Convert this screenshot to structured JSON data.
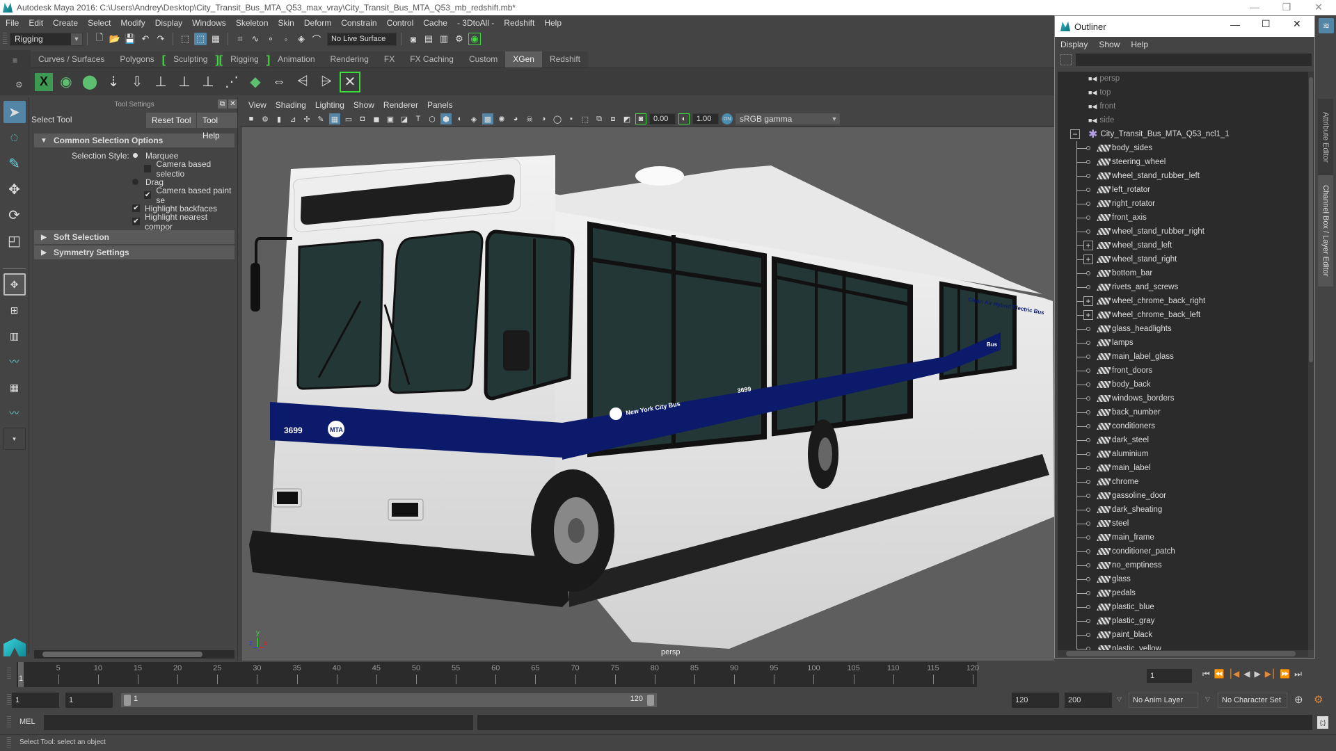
{
  "window": {
    "title": "Autodesk Maya 2016: C:\\Users\\Andrey\\Desktop\\City_Transit_Bus_MTA_Q53_max_vray\\City_Transit_Bus_MTA_Q53_mb_redshift.mb*",
    "minimize": "—",
    "restore": "❐",
    "close": "✕"
  },
  "menubar": [
    "File",
    "Edit",
    "Create",
    "Select",
    "Modify",
    "Display",
    "Windows",
    "Skeleton",
    "Skin",
    "Deform",
    "Constrain",
    "Control",
    "Cache",
    "- 3DtoAll -",
    "Redshift",
    "Help"
  ],
  "toolbar": {
    "menu_set": "Rigging",
    "live_surface": "No Live Surface"
  },
  "shelf": {
    "tabs": [
      {
        "label": "Curves / Surfaces"
      },
      {
        "label": "Polygons"
      },
      {
        "label": "Sculpting",
        "bracketed": true
      },
      {
        "label": "Rigging",
        "bracketed": true
      },
      {
        "label": "Animation"
      },
      {
        "label": "Rendering"
      },
      {
        "label": "FX"
      },
      {
        "label": "FX Caching"
      },
      {
        "label": "Custom"
      },
      {
        "label": "XGen",
        "active": true
      },
      {
        "label": "Redshift"
      }
    ]
  },
  "tool_settings": {
    "header": "Tool Settings",
    "tool_name": "Select Tool",
    "reset_button": "Reset Tool",
    "help_button": "Tool Help",
    "sections": {
      "common": "Common Selection Options",
      "soft": "Soft Selection",
      "symmetry": "Symmetry Settings"
    },
    "selection_style_label": "Selection Style:",
    "options": {
      "marquee": "Marquee",
      "camera_based_selection": "Camera based selectio",
      "drag": "Drag",
      "camera_based_paint": "Camera based paint se",
      "highlight_backfaces": "Highlight backfaces",
      "highlight_nearest": "Highlight nearest compor"
    },
    "states": {
      "marquee_selected": true,
      "camera_based_selection": false,
      "camera_based_paint": true,
      "highlight_backfaces": true,
      "highlight_nearest": true
    }
  },
  "viewport": {
    "menu": [
      "View",
      "Shading",
      "Lighting",
      "Show",
      "Renderer",
      "Panels"
    ],
    "exposure": "0.00",
    "gamma": "1.00",
    "color_space": "sRGB gamma",
    "camera_label": "persp",
    "axis": {
      "x": "x",
      "y": "y",
      "z": "z"
    },
    "bus_texts": {
      "front_number": "3699",
      "side_number": "3699",
      "side_label": "New York City Bus",
      "roof_label": "Clean Air Hybrid Electric Bus",
      "rear_label": "Bus",
      "logo": "MTA"
    }
  },
  "outliner": {
    "title": "Outliner",
    "menu": [
      "Display",
      "Show",
      "Help"
    ],
    "cameras": [
      "persp",
      "top",
      "front",
      "side"
    ],
    "root": "City_Transit_Bus_MTA_Q53_ncl1_1",
    "children": [
      {
        "name": "body_sides"
      },
      {
        "name": "steering_wheel"
      },
      {
        "name": "wheel_stand_rubber_left"
      },
      {
        "name": "left_rotator"
      },
      {
        "name": "right_rotator"
      },
      {
        "name": "front_axis"
      },
      {
        "name": "wheel_stand_rubber_right"
      },
      {
        "name": "wheel_stand_left",
        "expandable": true
      },
      {
        "name": "wheel_stand_right",
        "expandable": true
      },
      {
        "name": "bottom_bar"
      },
      {
        "name": "rivets_and_screws"
      },
      {
        "name": "wheel_chrome_back_right",
        "expandable": true
      },
      {
        "name": "wheel_chrome_back_left",
        "expandable": true
      },
      {
        "name": "glass_headlights"
      },
      {
        "name": "lamps"
      },
      {
        "name": "main_label_glass"
      },
      {
        "name": "front_doors"
      },
      {
        "name": "body_back"
      },
      {
        "name": "windows_borders"
      },
      {
        "name": "back_number"
      },
      {
        "name": "conditioners"
      },
      {
        "name": "dark_steel"
      },
      {
        "name": "aluminium"
      },
      {
        "name": "main_label"
      },
      {
        "name": "chrome"
      },
      {
        "name": "gassoline_door"
      },
      {
        "name": "dark_sheating"
      },
      {
        "name": "steel"
      },
      {
        "name": "main_frame"
      },
      {
        "name": "conditioner_patch"
      },
      {
        "name": "no_emptiness"
      },
      {
        "name": "glass"
      },
      {
        "name": "pedals"
      },
      {
        "name": "plastic_blue"
      },
      {
        "name": "plastic_gray"
      },
      {
        "name": "paint_black"
      },
      {
        "name": "plastic_yellow"
      }
    ]
  },
  "side_tabs": {
    "attribute_editor": "Attribute Editor",
    "channel_box": "Channel Box / Layer Editor"
  },
  "timeline": {
    "ticks": [
      5,
      10,
      15,
      20,
      25,
      30,
      35,
      40,
      45,
      50,
      55,
      60,
      65,
      70,
      75,
      80,
      85,
      90,
      95,
      100,
      105,
      110,
      115,
      120
    ],
    "range_start": 1,
    "range_end": 120,
    "current_frame": "1",
    "current_frame_marker": "1"
  },
  "range_slider": {
    "start_field": "1",
    "playback_start": "1",
    "slider_start": "1",
    "slider_end": "120",
    "playback_end": "120",
    "end_field": "200",
    "anim_layer": "No Anim Layer",
    "character_set": "No Character Set"
  },
  "command_line": {
    "label": "MEL",
    "value": ""
  },
  "status_line": "Select Tool: select an object"
}
